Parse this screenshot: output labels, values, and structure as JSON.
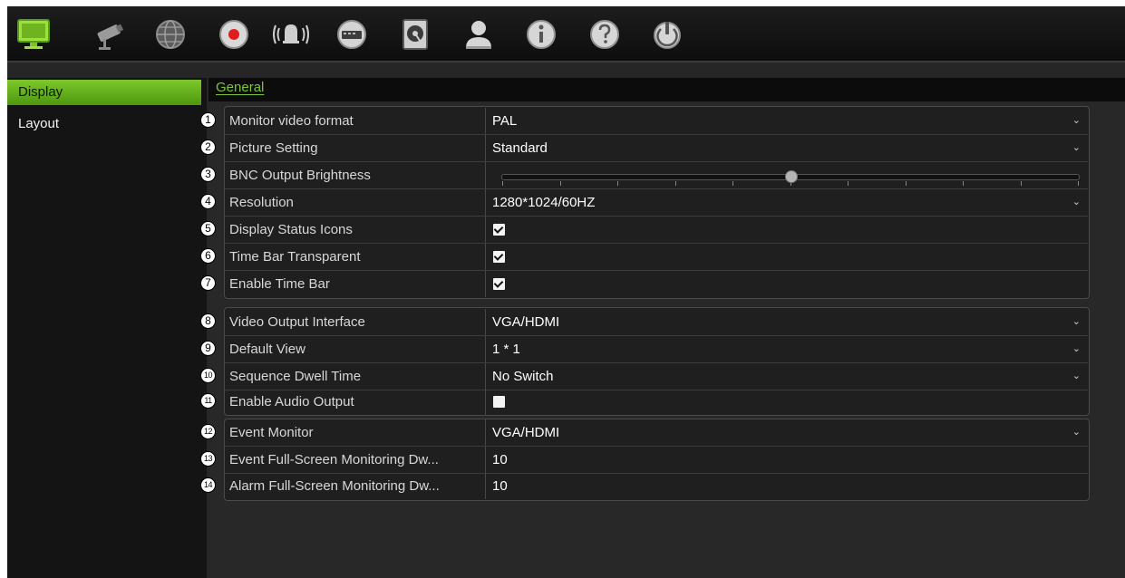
{
  "toolbar": {
    "icons": [
      "monitor-icon",
      "camera-icon",
      "network-icon",
      "record-icon",
      "alarm-icon",
      "device-icon",
      "storage-icon",
      "user-icon",
      "info-icon",
      "help-icon",
      "power-icon"
    ]
  },
  "sidebar": {
    "items": [
      {
        "label": "Display",
        "active": true
      },
      {
        "label": "Layout",
        "active": false
      }
    ]
  },
  "main": {
    "tab": "General",
    "rows": [
      {
        "num": "1",
        "label": "Monitor video format",
        "value": "PAL",
        "type": "select"
      },
      {
        "num": "2",
        "label": "Picture Setting",
        "value": "Standard",
        "type": "select"
      },
      {
        "num": "3",
        "label": "BNC Output Brightness",
        "type": "slider",
        "level_percent": 50
      },
      {
        "num": "4",
        "label": "Resolution",
        "value": "1280*1024/60HZ",
        "type": "select"
      },
      {
        "num": "5",
        "label": "Display Status Icons",
        "type": "checkbox",
        "checked": true
      },
      {
        "num": "6",
        "label": "Time Bar Transparent",
        "type": "checkbox",
        "checked": true
      },
      {
        "num": "7",
        "label": "Enable Time Bar",
        "type": "checkbox",
        "checked": true
      },
      {
        "num": "8",
        "label": "Video Output Interface",
        "value": "VGA/HDMI",
        "type": "select"
      },
      {
        "num": "9",
        "label": "Default View",
        "value": "1 * 1",
        "type": "select"
      },
      {
        "num": "10",
        "label": "Sequence Dwell Time",
        "value": "No Switch",
        "type": "select"
      },
      {
        "num": "11",
        "label": "Enable Audio Output",
        "type": "checkbox",
        "checked": false
      },
      {
        "num": "12",
        "label": "Event Monitor",
        "value": "VGA/HDMI",
        "type": "select"
      },
      {
        "num": "13",
        "label": "Event Full-Screen Monitoring Dw...",
        "value": "10",
        "type": "text"
      },
      {
        "num": "14",
        "label": "Alarm Full-Screen Monitoring Dw...",
        "value": "10",
        "type": "text"
      }
    ]
  },
  "colors": {
    "accent": "#7ec536",
    "background": "#282828"
  }
}
